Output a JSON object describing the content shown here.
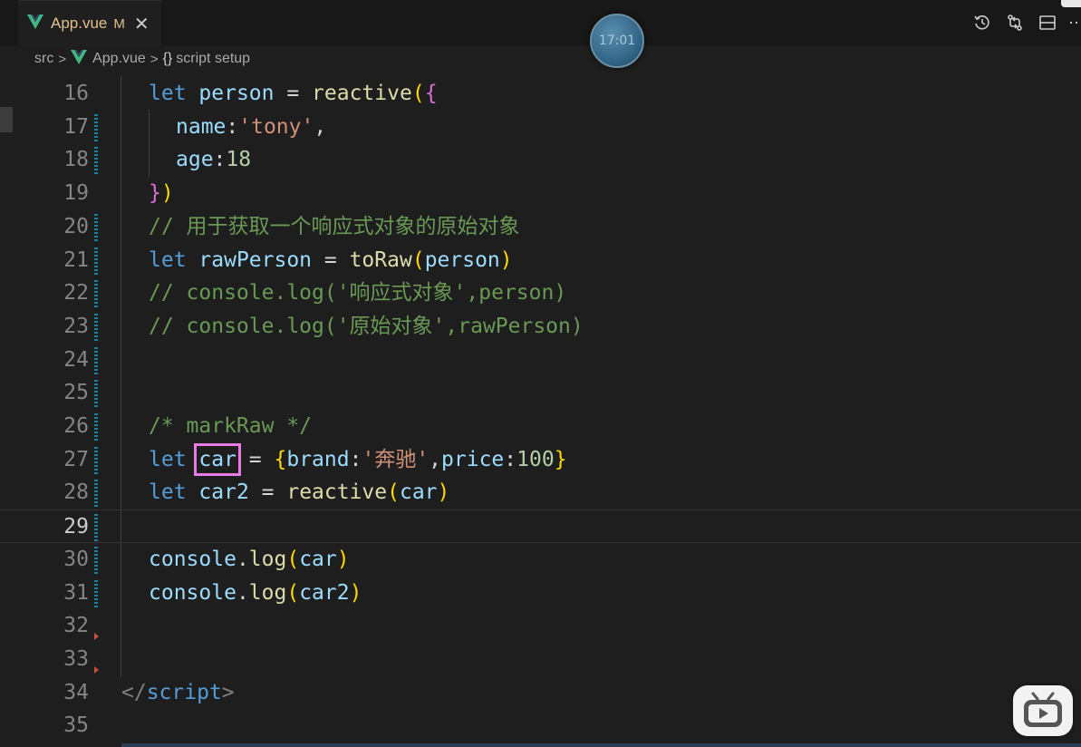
{
  "tab": {
    "title": "App.vue",
    "status": "M",
    "close": "✕"
  },
  "overlay": {
    "clock_time": "17:01"
  },
  "toolbar": {
    "more": "⋯"
  },
  "breadcrumb": {
    "folder": "src",
    "sep1": ">",
    "file": "App.vue",
    "sep2": ">",
    "braces": "{}",
    "symbol": "script setup"
  },
  "editor": {
    "lines": [
      {
        "num": "16",
        "t1": "let",
        "t2": " ",
        "t3": "person",
        "t4": " = ",
        "t5": "reactive",
        "t6": "(",
        "t7": "{"
      },
      {
        "num": "17",
        "t1": "name",
        "t2": ":",
        "t3": "'tony'",
        "t4": ","
      },
      {
        "num": "18",
        "t1": "age",
        "t2": ":",
        "t3": "18"
      },
      {
        "num": "19",
        "t1": "}",
        "t2": ")"
      },
      {
        "num": "20",
        "t1": "// 用于获取一个响应式对象的原始对象"
      },
      {
        "num": "21",
        "t1": "let",
        "t2": " ",
        "t3": "rawPerson",
        "t4": " = ",
        "t5": "toRaw",
        "t6": "(",
        "t7": "person",
        "t8": ")"
      },
      {
        "num": "22",
        "t1": "// console.log('响应式对象',person)"
      },
      {
        "num": "23",
        "t1": "// console.log('原始对象',rawPerson)"
      },
      {
        "num": "24"
      },
      {
        "num": "25"
      },
      {
        "num": "26",
        "t1": "/* markRaw */"
      },
      {
        "num": "27",
        "t1": "let",
        "t2": " ",
        "t3": "car",
        "t4": " = ",
        "t5": "{",
        "t6": "brand",
        "t7": ":",
        "t8": "'奔驰'",
        "t9": ",",
        "t10": "price",
        "t11": ":",
        "t12": "100",
        "t13": "}"
      },
      {
        "num": "28",
        "t1": "let",
        "t2": " ",
        "t3": "car2",
        "t4": " = ",
        "t5": "reactive",
        "t6": "(",
        "t7": "car",
        "t8": ")"
      },
      {
        "num": "29"
      },
      {
        "num": "30",
        "t1": "console",
        "t2": ".",
        "t3": "log",
        "t4": "(",
        "t5": "car",
        "t6": ")"
      },
      {
        "num": "31",
        "t1": "console",
        "t2": ".",
        "t3": "log",
        "t4": "(",
        "t5": "car2",
        "t6": ")"
      },
      {
        "num": "32"
      },
      {
        "num": "33"
      },
      {
        "num": "34",
        "t1": "</",
        "t2": "script",
        "t3": ">"
      },
      {
        "num": "35"
      }
    ]
  },
  "colors": {
    "background": "#1e1e1e",
    "keyword": "#569cd6",
    "variable": "#9cdcfe",
    "function": "#dcdcaa",
    "string": "#ce9178",
    "number": "#b5cea8",
    "comment": "#6a9955",
    "highlight_box": "#e97ae6",
    "modified_file": "#e2c08d",
    "vue_green": "#41b883"
  },
  "icons": [
    "vue-logo-icon",
    "close-icon",
    "timeline-icon",
    "compare-changes-icon",
    "split-editor-icon",
    "more-actions-icon",
    "bilibili-icon"
  ]
}
